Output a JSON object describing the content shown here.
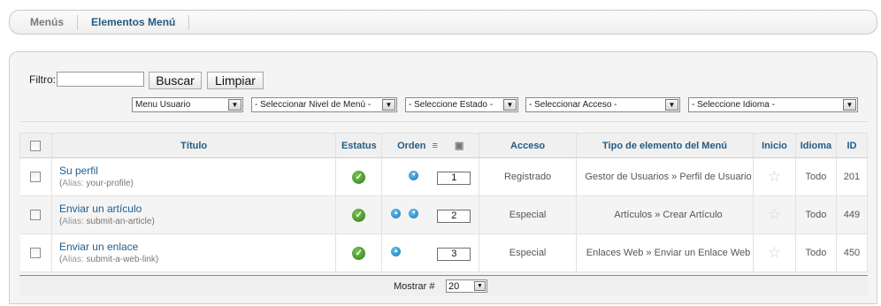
{
  "tabs": [
    {
      "label": "Menús",
      "active": false
    },
    {
      "label": "Elementos Menú",
      "active": true
    }
  ],
  "filters": {
    "label": "Filtro:",
    "input_value": "",
    "search_button": "Buscar",
    "clear_button": "Limpiar",
    "selects": [
      {
        "value": "Menu Usuario"
      },
      {
        "value": "- Seleccionar Nivel de Menú -"
      },
      {
        "value": "- Seleccione Estado -"
      },
      {
        "value": "- Seleccionar Acceso -"
      },
      {
        "value": "- Seleccione Idioma -"
      }
    ]
  },
  "table": {
    "headers": {
      "title": "Título",
      "status": "Estatus",
      "order": "Orden",
      "access": "Acceso",
      "type": "Tipo de elemento del Menú",
      "home": "Inicio",
      "language": "Idioma",
      "id": "ID"
    },
    "rows": [
      {
        "title": "Su perfil",
        "alias_label": "Alias:",
        "alias": "your-profile",
        "order": "1",
        "access": "Registrado",
        "type": "Gestor de Usuarios » Perfil de Usuario",
        "language": "Todo",
        "id": "201"
      },
      {
        "title": "Enviar un artículo",
        "alias_label": "Alias:",
        "alias": "submit-an-article",
        "order": "2",
        "access": "Especial",
        "type": "Artículos » Crear Artículo",
        "language": "Todo",
        "id": "449"
      },
      {
        "title": "Enviar un enlace",
        "alias_label": "Alias:",
        "alias": "submit-a-web-link",
        "order": "3",
        "access": "Especial",
        "type": "Enlaces Web » Enviar un Enlace Web",
        "language": "Todo",
        "id": "450"
      }
    ]
  },
  "pagination": {
    "label": "Mostrar #",
    "value": "20"
  },
  "colors": {
    "link": "#1f5e8f",
    "header_text": "#245b84",
    "status_ok": "#3a8f1f",
    "order_arrow": "#1878b0"
  }
}
